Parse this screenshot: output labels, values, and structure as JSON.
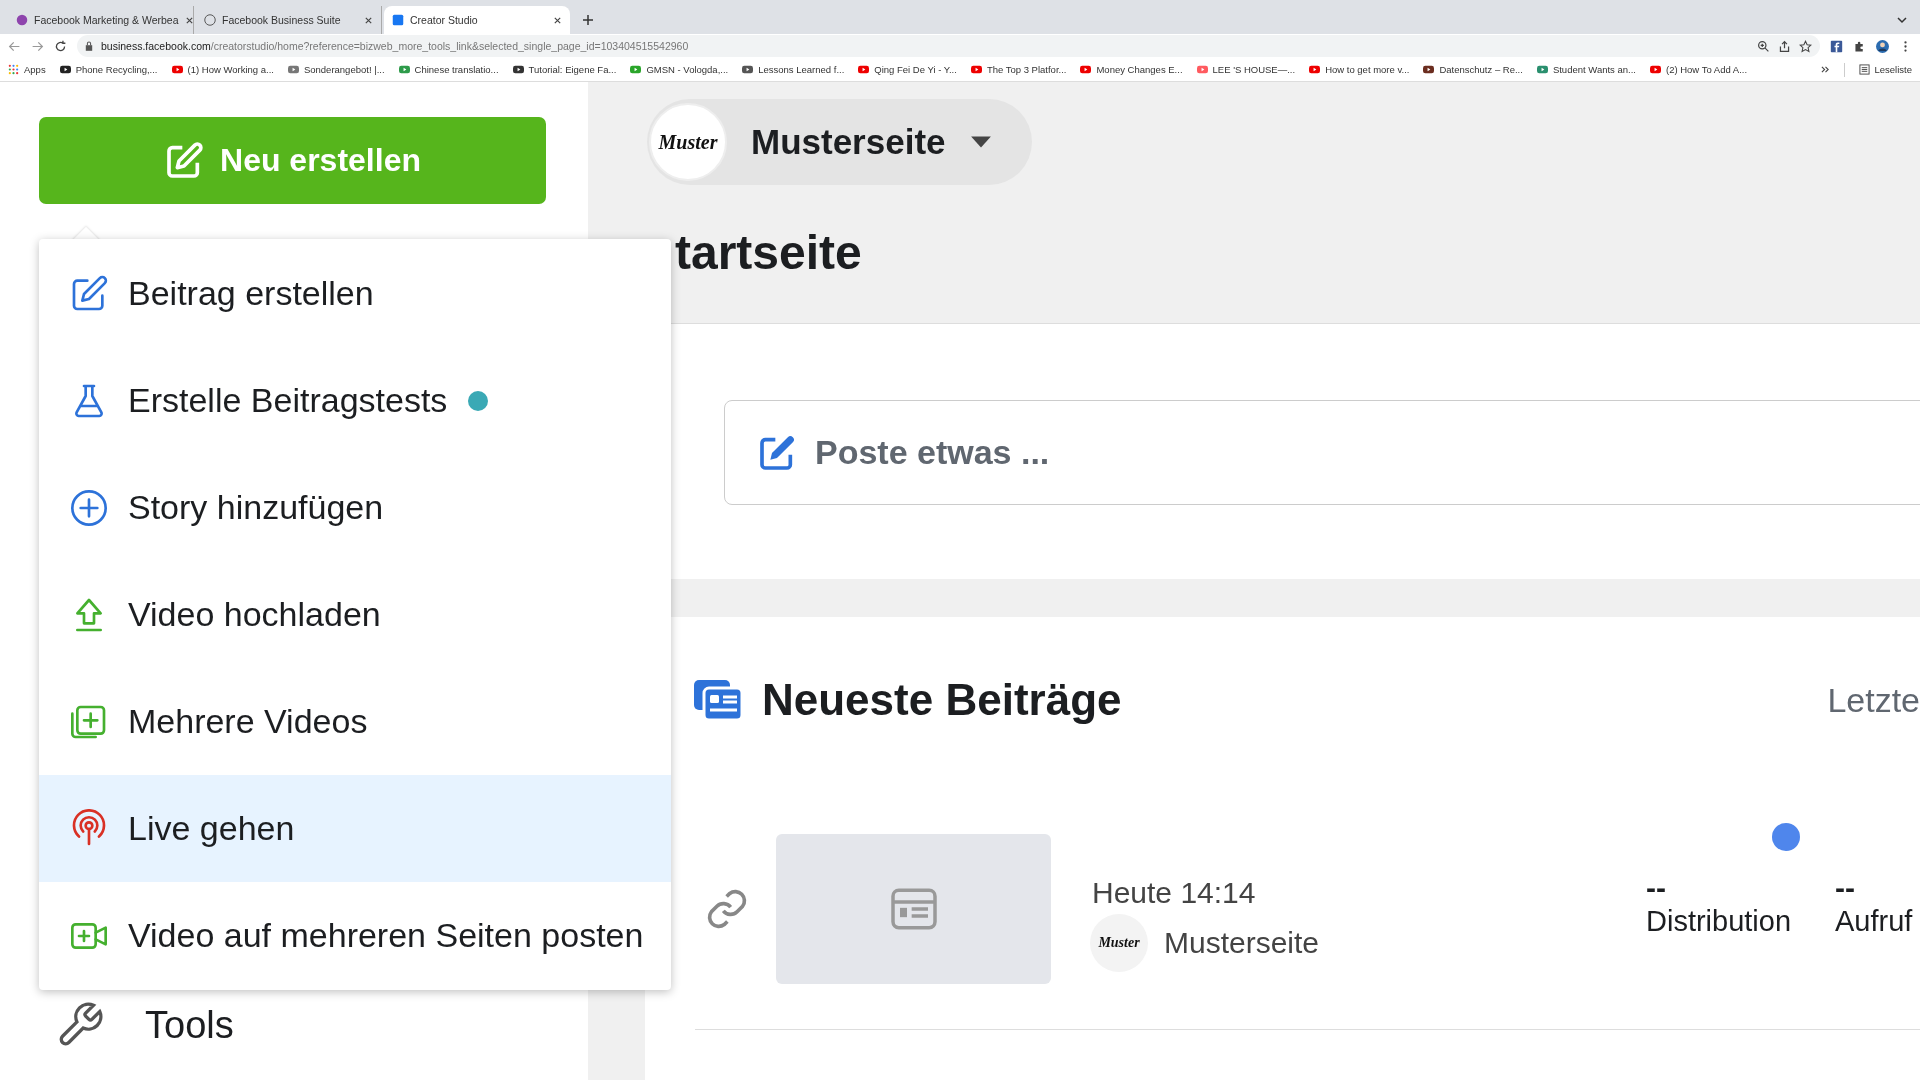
{
  "browser": {
    "tabs": [
      {
        "title": "Facebook Marketing & Werbea",
        "selected": false
      },
      {
        "title": "Facebook Business Suite",
        "selected": false
      },
      {
        "title": "Creator Studio",
        "selected": true
      }
    ],
    "address": {
      "host": "business.facebook.com",
      "path": "/creatorstudio/home?reference=bizweb_more_tools_link&selected_single_page_id=103404515542960"
    },
    "bookmarks": [
      "Apps",
      "Phone Recycling,...",
      "(1) How Working a...",
      "Sonderangebot! |...",
      "Chinese translatio...",
      "Tutorial: Eigene Fa...",
      "GMSN - Vologda,...",
      "Lessons Learned f...",
      "Qing Fei De Yi - Y...",
      "The Top 3 Platfor...",
      "Money Changes E...",
      "LEE 'S HOUSE—...",
      "How to get more v...",
      "Datenschutz – Re...",
      "Student Wants an...",
      "(2) How To Add A..."
    ],
    "reading_list": "Leseliste"
  },
  "sidebar": {
    "create_button": "Neu erstellen",
    "tools": "Tools"
  },
  "create_menu": [
    {
      "label": "Beitrag erstellen",
      "selected": false,
      "dot": false
    },
    {
      "label": "Erstelle Beitragstests",
      "selected": false,
      "dot": true
    },
    {
      "label": "Story hinzufügen",
      "selected": false,
      "dot": false
    },
    {
      "label": "Video hochladen",
      "selected": false,
      "dot": false
    },
    {
      "label": "Mehrere Videos",
      "selected": false,
      "dot": false
    },
    {
      "label": "Live gehen",
      "selected": true,
      "dot": false
    },
    {
      "label": "Video auf mehreren Seiten posten",
      "selected": false,
      "dot": false
    }
  ],
  "page_switcher": {
    "logo_text": "Muster",
    "name": "Musterseite"
  },
  "heading": "tartseite",
  "composer": {
    "placeholder": "Poste etwas ..."
  },
  "recent_posts": {
    "title": "Neueste Beiträge",
    "filter": "Letzte",
    "posts": [
      {
        "time": "Heute 14:14",
        "avatar_text": "Muster",
        "page": "Musterseite",
        "new": true,
        "stats": [
          {
            "value": "--",
            "label": "Distribution"
          },
          {
            "value": "--",
            "label": "Aufruf"
          }
        ]
      }
    ]
  }
}
